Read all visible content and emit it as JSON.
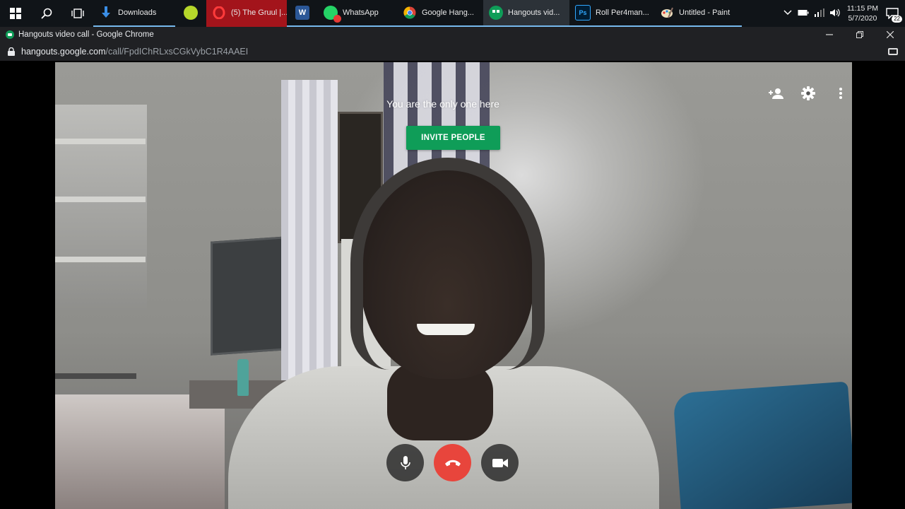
{
  "taskbar": {
    "downloads_label": "Downloads",
    "opera_label": "(5) The Gruul |...",
    "whatsapp_label": "WhatsApp",
    "whatsapp_badge": "",
    "chrome_hangouts_label": "Google Hang...",
    "hangouts_video_label": "Hangouts vid...",
    "photoshop_label": "Roll Per4man...",
    "paint_label": "Untitled - Paint",
    "clock_time": "11:15 PM",
    "clock_date": "5/7/2020",
    "notification_count": "22"
  },
  "browser": {
    "window_title": "Hangouts video call - Google Chrome",
    "url_host": "hangouts.google.com",
    "url_path": "/call/FpdIChRLxsCGkVybC1R4AAEI"
  },
  "call": {
    "status_text": "You are the only one here",
    "invite_label": "INVITE PEOPLE"
  },
  "colors": {
    "invite_green": "#0f9d58",
    "hangup_red": "#e8453c",
    "taskbar_bg": "#101418"
  }
}
